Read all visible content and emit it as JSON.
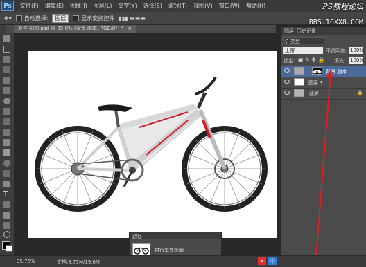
{
  "app": {
    "logo": "Ps"
  },
  "menu": [
    "文件(F)",
    "编辑(E)",
    "图像(I)",
    "图层(L)",
    "文字(Y)",
    "选择(S)",
    "滤镜(T)",
    "视图(V)",
    "窗口(W)",
    "帮助(H)"
  ],
  "watermark": {
    "top": "PS教程论坛",
    "bottom": "BBS.16XX8.COM"
  },
  "options": {
    "auto_select_label": "自动选择:",
    "auto_select_value": "图层",
    "show_transform_label": "显示变换控件"
  },
  "document_tab": {
    "title": "复件 贴图.psd @ 35.8% (背景 副本, RGB/8*) *",
    "close": "×"
  },
  "status": {
    "zoom": "35.75%",
    "doc_info": "文档:8.73M/19.6M"
  },
  "panels": {
    "tabs": [
      "图层",
      "历史记录"
    ],
    "filter_label": "类型",
    "blend_mode": "正常",
    "opacity_label": "不透明度:",
    "opacity_value": "100%",
    "lock_label": "锁定:",
    "fill_label": "填充:",
    "fill_value": "100%",
    "layers": [
      {
        "name": "背景 副本",
        "selected": true
      },
      {
        "name": "图层 1",
        "selected": false
      },
      {
        "name": "背景",
        "selected": false
      }
    ],
    "bottom_icons": [
      "link-icon",
      "fx-icon",
      "add-mask-icon",
      "adjustment-icon",
      "group-icon",
      "new-layer-icon",
      "delete-icon"
    ]
  },
  "paths_panel": {
    "title": "路径",
    "path_name": "自行车外轮廓"
  },
  "taskbar": {
    "ime": "中"
  },
  "colors": {
    "annotation": "#e02020",
    "selected_layer": "#4a6a9a",
    "accent": "#2f7fd6"
  }
}
